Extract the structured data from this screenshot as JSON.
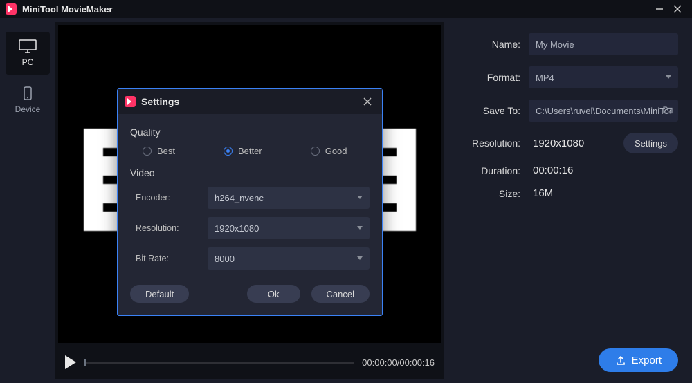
{
  "app": {
    "title": "MiniTool MovieMaker"
  },
  "leftnav": {
    "pc": "PC",
    "device": "Device"
  },
  "preview": {
    "time_current": "00:00:00",
    "time_total": "00:00:16"
  },
  "export": {
    "name_label": "Name:",
    "name_value": "My Movie",
    "format_label": "Format:",
    "format_value": "MP4",
    "saveto_label": "Save To:",
    "saveto_value": "C:\\Users\\ruvel\\Documents\\MiniTool MovieMak",
    "resolution_label": "Resolution:",
    "resolution_value": "1920x1080",
    "settings_btn": "Settings",
    "duration_label": "Duration:",
    "duration_value": "00:00:16",
    "size_label": "Size:",
    "size_value": "16M",
    "export_btn": "Export"
  },
  "modal": {
    "title": "Settings",
    "quality_title": "Quality",
    "quality_best": "Best",
    "quality_better": "Better",
    "quality_good": "Good",
    "quality_selected": "Better",
    "video_title": "Video",
    "encoder_label": "Encoder:",
    "encoder_value": "h264_nvenc",
    "resolution_label": "Resolution:",
    "resolution_value": "1920x1080",
    "bitrate_label": "Bit Rate:",
    "bitrate_value": "8000",
    "btn_default": "Default",
    "btn_ok": "Ok",
    "btn_cancel": "Cancel"
  }
}
